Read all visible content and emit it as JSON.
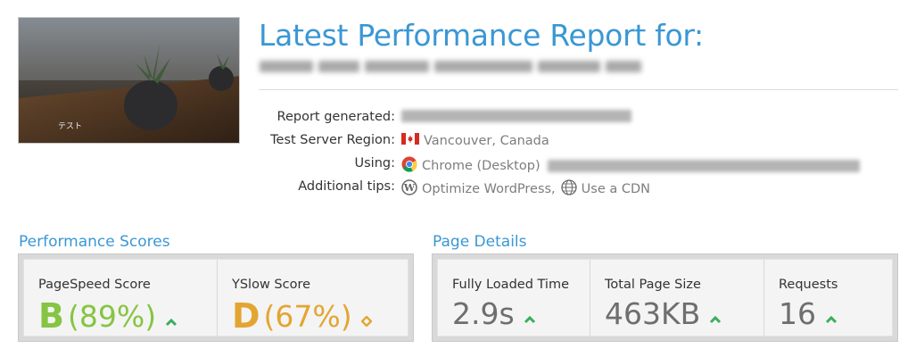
{
  "header": {
    "title": "Latest Performance Report for:"
  },
  "thumbnail": {
    "caption": "テスト"
  },
  "meta": [
    {
      "label": "Report generated:",
      "value": ""
    },
    {
      "label": "Test Server Region:",
      "value": "Vancouver, Canada",
      "icon": "canada-flag-icon"
    },
    {
      "label": "Using:",
      "value": "Chrome (Desktop)",
      "icon": "chrome-icon"
    },
    {
      "label": "Additional tips:",
      "tip1": "Optimize WordPress,",
      "tip2": "Use a CDN",
      "icon1": "wordpress-icon",
      "icon2": "globe-icon"
    }
  ],
  "performance": {
    "title": "Performance Scores",
    "pagespeed": {
      "label": "PageSpeed Score",
      "grade": "B",
      "percent": "(89%)",
      "trend": "up",
      "color": "#86c541"
    },
    "yslow": {
      "label": "YSlow Score",
      "grade": "D",
      "percent": "(67%)",
      "trend": "diamond",
      "color": "#e3a532"
    }
  },
  "page_details": {
    "title": "Page Details",
    "load_time": {
      "label": "Fully Loaded Time",
      "value": "2.9s",
      "trend": "up"
    },
    "page_size": {
      "label": "Total Page Size",
      "value": "463KB",
      "trend": "up"
    },
    "requests": {
      "label": "Requests",
      "value": "16",
      "trend": "up"
    }
  },
  "colors": {
    "accent": "#3a97d4",
    "good": "#86c541",
    "warn": "#e3a532"
  }
}
